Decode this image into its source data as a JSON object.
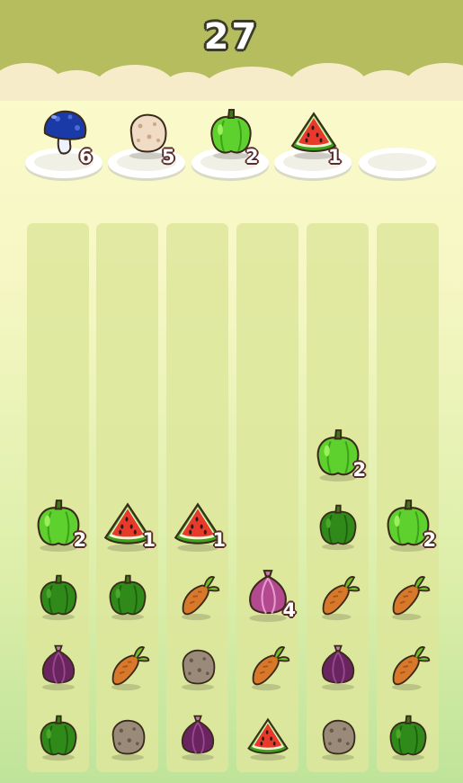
{
  "score": "27",
  "colors": {
    "header": "#b5bd5f",
    "column": "#dde69b",
    "count_outline": "#5a2b2b"
  },
  "slots": [
    {
      "icon": "mushroom-icon",
      "count": "6"
    },
    {
      "icon": "potato-icon",
      "count": "5"
    },
    {
      "icon": "pepper-icon",
      "count": "2"
    },
    {
      "icon": "watermelon-icon",
      "count": "1"
    },
    {
      "icon": "empty-plate",
      "count": ""
    }
  ],
  "columns": [
    {
      "stack": [
        {
          "icon": "pepper-icon",
          "count": "2"
        },
        {
          "icon": "pepper-icon",
          "dark": true
        },
        {
          "icon": "onion-icon"
        },
        {
          "icon": "pepper-icon",
          "dark": true
        }
      ]
    },
    {
      "stack": [
        {
          "icon": "watermelon-icon",
          "count": "1"
        },
        {
          "icon": "pepper-icon",
          "dark": true
        },
        {
          "icon": "carrot-icon"
        },
        {
          "icon": "potato-icon",
          "dark": true
        }
      ]
    },
    {
      "stack": [
        {
          "icon": "watermelon-icon",
          "count": "1"
        },
        {
          "icon": "carrot-icon"
        },
        {
          "icon": "potato-icon",
          "dark": true
        },
        {
          "icon": "onion-icon"
        }
      ]
    },
    {
      "stack": [
        {
          "icon": "onion-icon",
          "count": "4",
          "bright": true
        },
        {
          "icon": "carrot-icon"
        },
        {
          "icon": "watermelon-icon"
        }
      ]
    },
    {
      "stack": [
        {
          "icon": "pepper-icon",
          "count": "2"
        },
        {
          "icon": "pepper-icon",
          "dark": true
        },
        {
          "icon": "carrot-icon"
        },
        {
          "icon": "onion-icon"
        },
        {
          "icon": "potato-icon",
          "dark": true
        }
      ]
    },
    {
      "stack": [
        {
          "icon": "pepper-icon",
          "count": "2"
        },
        {
          "icon": "carrot-icon"
        },
        {
          "icon": "carrot-icon"
        },
        {
          "icon": "pepper-icon",
          "dark": true
        }
      ]
    }
  ]
}
